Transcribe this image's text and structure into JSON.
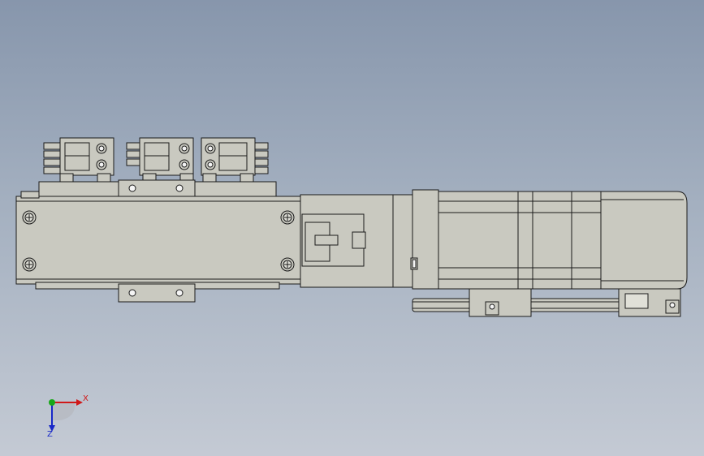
{
  "viewport": {
    "background_top": "#8796ac",
    "background_bottom": "#c4cad4"
  },
  "part_colors": {
    "body": "#c9c9c0",
    "edge": "#1a1a1a",
    "hole": "#f4f4f4"
  },
  "triad": {
    "x_label": "X",
    "z_label": "Z",
    "x_color": "#d01818",
    "y_color": "#18a818",
    "z_color": "#1828c8"
  }
}
